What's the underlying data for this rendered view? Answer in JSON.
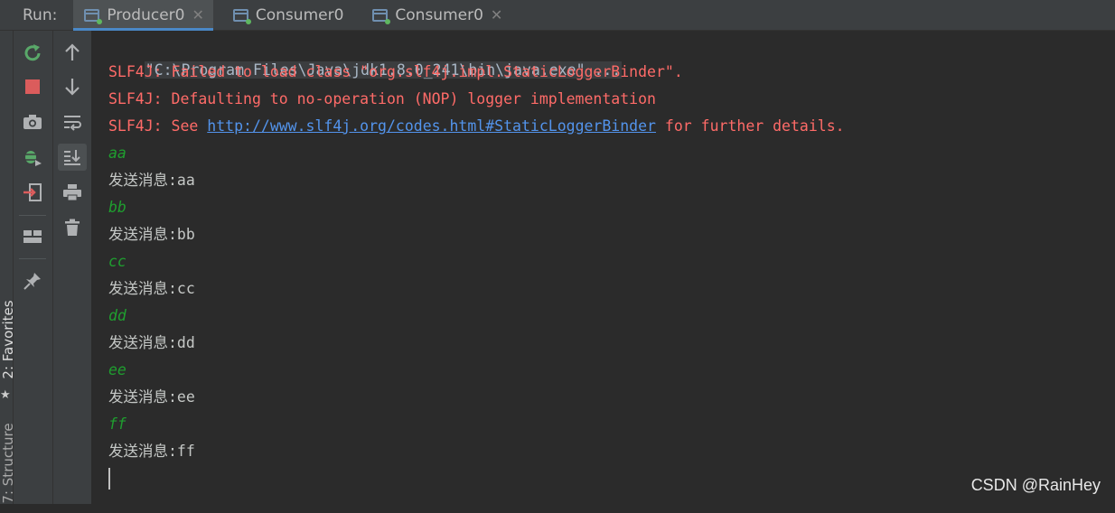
{
  "run_bar": {
    "label": "Run:",
    "tabs": [
      {
        "label": "Producer0",
        "active": true
      },
      {
        "label": "Consumer0",
        "active": false
      },
      {
        "label": "Consumer0",
        "active": false
      }
    ]
  },
  "side_panels": {
    "favorites": "2: Favorites",
    "structure": "7: Structure"
  },
  "console": {
    "command": "\"C:\\Program Files\\Java\\jdk1.8.0_241\\bin\\java.exe\" ...",
    "slf4j_line1": "SLF4J: Failed to load class \"org.slf4j.impl.StaticLoggerBinder\".",
    "slf4j_line2": "SLF4J: Defaulting to no-operation (NOP) logger implementation",
    "slf4j_line3_prefix": "SLF4J: See ",
    "slf4j_line3_link": "http://www.slf4j.org/codes.html#StaticLoggerBinder",
    "slf4j_line3_suffix": " for further details.",
    "entries": [
      {
        "input": "aa",
        "output": "发送消息:aa"
      },
      {
        "input": "bb",
        "output": "发送消息:bb"
      },
      {
        "input": "cc",
        "output": "发送消息:cc"
      },
      {
        "input": "dd",
        "output": "发送消息:dd"
      },
      {
        "input": "ee",
        "output": "发送消息:ee"
      },
      {
        "input": "ff",
        "output": "发送消息:ff"
      }
    ]
  },
  "watermark": "CSDN @RainHey",
  "colors": {
    "error": "#ff6b68",
    "link": "#5394ec",
    "user_input": "#1f9e2f",
    "active_tab_underline": "#4a88c7"
  },
  "icons": {
    "rerun": "rerun-icon",
    "stop": "stop-icon",
    "dump": "camera-icon",
    "debug": "bug-icon",
    "exit": "exit-icon",
    "layout": "layout-icon",
    "pin": "pin-icon",
    "up": "arrow-up-icon",
    "down": "arrow-down-icon",
    "wrap": "soft-wrap-icon",
    "scroll": "scroll-to-end-icon",
    "print": "print-icon",
    "clear": "trash-icon"
  }
}
